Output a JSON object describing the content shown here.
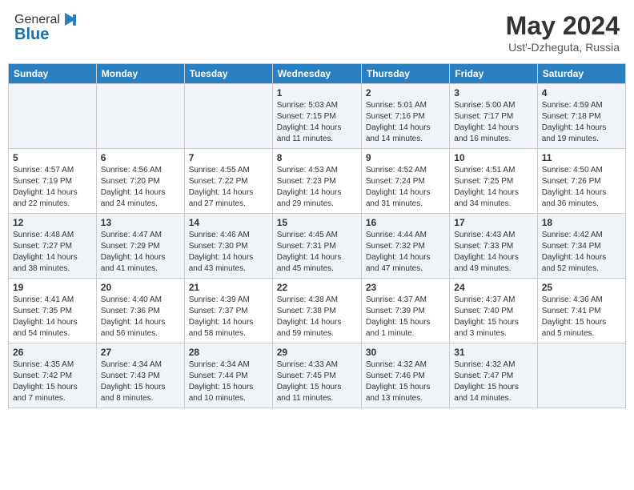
{
  "header": {
    "logo_line1": "General",
    "logo_line2": "Blue",
    "month_title": "May 2024",
    "location": "Ust'-Dzheguta, Russia"
  },
  "weekdays": [
    "Sunday",
    "Monday",
    "Tuesday",
    "Wednesday",
    "Thursday",
    "Friday",
    "Saturday"
  ],
  "weeks": [
    [
      {
        "day": "",
        "content": ""
      },
      {
        "day": "",
        "content": ""
      },
      {
        "day": "",
        "content": ""
      },
      {
        "day": "1",
        "content": "Sunrise: 5:03 AM\nSunset: 7:15 PM\nDaylight: 14 hours\nand 11 minutes."
      },
      {
        "day": "2",
        "content": "Sunrise: 5:01 AM\nSunset: 7:16 PM\nDaylight: 14 hours\nand 14 minutes."
      },
      {
        "day": "3",
        "content": "Sunrise: 5:00 AM\nSunset: 7:17 PM\nDaylight: 14 hours\nand 16 minutes."
      },
      {
        "day": "4",
        "content": "Sunrise: 4:59 AM\nSunset: 7:18 PM\nDaylight: 14 hours\nand 19 minutes."
      }
    ],
    [
      {
        "day": "5",
        "content": "Sunrise: 4:57 AM\nSunset: 7:19 PM\nDaylight: 14 hours\nand 22 minutes."
      },
      {
        "day": "6",
        "content": "Sunrise: 4:56 AM\nSunset: 7:20 PM\nDaylight: 14 hours\nand 24 minutes."
      },
      {
        "day": "7",
        "content": "Sunrise: 4:55 AM\nSunset: 7:22 PM\nDaylight: 14 hours\nand 27 minutes."
      },
      {
        "day": "8",
        "content": "Sunrise: 4:53 AM\nSunset: 7:23 PM\nDaylight: 14 hours\nand 29 minutes."
      },
      {
        "day": "9",
        "content": "Sunrise: 4:52 AM\nSunset: 7:24 PM\nDaylight: 14 hours\nand 31 minutes."
      },
      {
        "day": "10",
        "content": "Sunrise: 4:51 AM\nSunset: 7:25 PM\nDaylight: 14 hours\nand 34 minutes."
      },
      {
        "day": "11",
        "content": "Sunrise: 4:50 AM\nSunset: 7:26 PM\nDaylight: 14 hours\nand 36 minutes."
      }
    ],
    [
      {
        "day": "12",
        "content": "Sunrise: 4:48 AM\nSunset: 7:27 PM\nDaylight: 14 hours\nand 38 minutes."
      },
      {
        "day": "13",
        "content": "Sunrise: 4:47 AM\nSunset: 7:29 PM\nDaylight: 14 hours\nand 41 minutes."
      },
      {
        "day": "14",
        "content": "Sunrise: 4:46 AM\nSunset: 7:30 PM\nDaylight: 14 hours\nand 43 minutes."
      },
      {
        "day": "15",
        "content": "Sunrise: 4:45 AM\nSunset: 7:31 PM\nDaylight: 14 hours\nand 45 minutes."
      },
      {
        "day": "16",
        "content": "Sunrise: 4:44 AM\nSunset: 7:32 PM\nDaylight: 14 hours\nand 47 minutes."
      },
      {
        "day": "17",
        "content": "Sunrise: 4:43 AM\nSunset: 7:33 PM\nDaylight: 14 hours\nand 49 minutes."
      },
      {
        "day": "18",
        "content": "Sunrise: 4:42 AM\nSunset: 7:34 PM\nDaylight: 14 hours\nand 52 minutes."
      }
    ],
    [
      {
        "day": "19",
        "content": "Sunrise: 4:41 AM\nSunset: 7:35 PM\nDaylight: 14 hours\nand 54 minutes."
      },
      {
        "day": "20",
        "content": "Sunrise: 4:40 AM\nSunset: 7:36 PM\nDaylight: 14 hours\nand 56 minutes."
      },
      {
        "day": "21",
        "content": "Sunrise: 4:39 AM\nSunset: 7:37 PM\nDaylight: 14 hours\nand 58 minutes."
      },
      {
        "day": "22",
        "content": "Sunrise: 4:38 AM\nSunset: 7:38 PM\nDaylight: 14 hours\nand 59 minutes."
      },
      {
        "day": "23",
        "content": "Sunrise: 4:37 AM\nSunset: 7:39 PM\nDaylight: 15 hours\nand 1 minute."
      },
      {
        "day": "24",
        "content": "Sunrise: 4:37 AM\nSunset: 7:40 PM\nDaylight: 15 hours\nand 3 minutes."
      },
      {
        "day": "25",
        "content": "Sunrise: 4:36 AM\nSunset: 7:41 PM\nDaylight: 15 hours\nand 5 minutes."
      }
    ],
    [
      {
        "day": "26",
        "content": "Sunrise: 4:35 AM\nSunset: 7:42 PM\nDaylight: 15 hours\nand 7 minutes."
      },
      {
        "day": "27",
        "content": "Sunrise: 4:34 AM\nSunset: 7:43 PM\nDaylight: 15 hours\nand 8 minutes."
      },
      {
        "day": "28",
        "content": "Sunrise: 4:34 AM\nSunset: 7:44 PM\nDaylight: 15 hours\nand 10 minutes."
      },
      {
        "day": "29",
        "content": "Sunrise: 4:33 AM\nSunset: 7:45 PM\nDaylight: 15 hours\nand 11 minutes."
      },
      {
        "day": "30",
        "content": "Sunrise: 4:32 AM\nSunset: 7:46 PM\nDaylight: 15 hours\nand 13 minutes."
      },
      {
        "day": "31",
        "content": "Sunrise: 4:32 AM\nSunset: 7:47 PM\nDaylight: 15 hours\nand 14 minutes."
      },
      {
        "day": "",
        "content": ""
      }
    ]
  ]
}
